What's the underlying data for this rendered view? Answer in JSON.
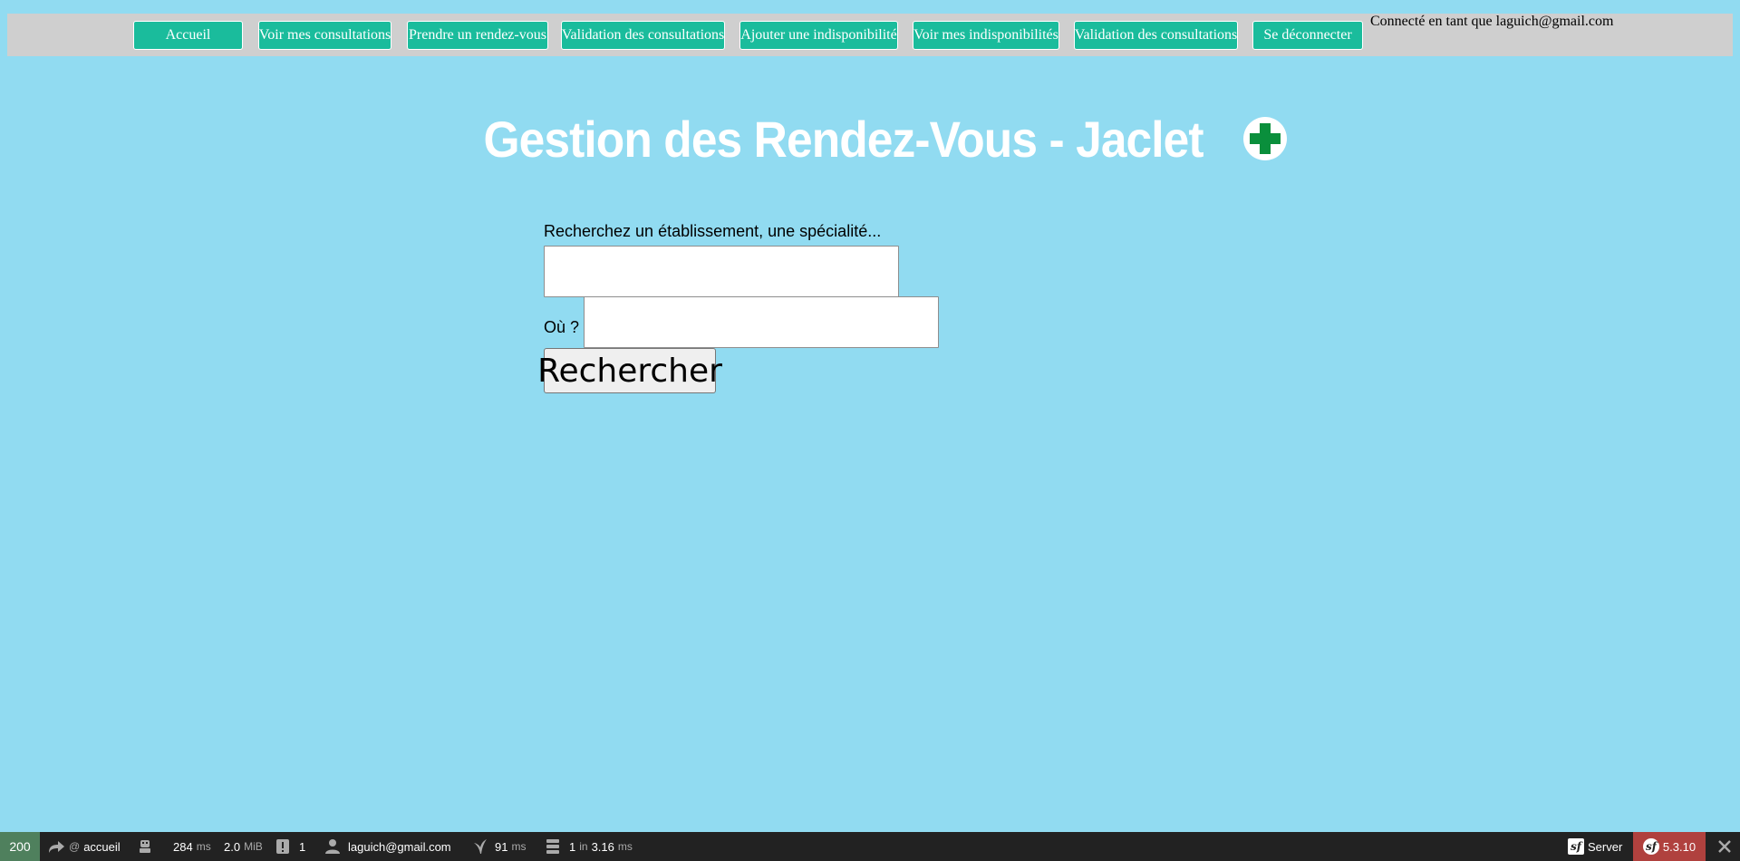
{
  "nav": {
    "items": [
      {
        "label": "Accueil"
      },
      {
        "label": "Voir mes consultations"
      },
      {
        "label": "Prendre un rendez-vous"
      },
      {
        "label": "Validation des consultations"
      },
      {
        "label": "Ajouter une indisponibilité"
      },
      {
        "label": "Voir mes indisponibilités"
      },
      {
        "label": "Validation des consultations"
      },
      {
        "label": "Se déconnecter"
      }
    ],
    "connected_text": "Connecté en tant que laguich@gmail.com"
  },
  "header": {
    "title": "Gestion des Rendez-Vous - Jaclet",
    "logo_icon": "medical-cross-icon"
  },
  "search": {
    "what_label": "Recherchez un établissement, une spécialité...",
    "what_value": "",
    "where_label": "Où ?",
    "where_value": "",
    "button_label": "Rechercher"
  },
  "debug_toolbar": {
    "status_code": "200",
    "route_prefix": "@",
    "route": "accueil",
    "time_value": "284",
    "time_unit": "ms",
    "memory_value": "2.0",
    "memory_unit": "MiB",
    "logs_count": "1",
    "user": "laguich@gmail.com",
    "twig_time_value": "91",
    "twig_time_unit": "ms",
    "db_queries": "1",
    "db_in": "in",
    "db_time_value": "3.16",
    "db_time_unit": "ms",
    "server_label": "Server",
    "version": "5.3.10"
  },
  "colors": {
    "background": "#91dbf1",
    "nav_bar": "#cfcfcf",
    "nav_button": "#1abc9c",
    "logo_green": "#0a8f3c",
    "toolbar": "#222222",
    "status_ok": "#4f805d",
    "version_badge": "#b0413e"
  }
}
